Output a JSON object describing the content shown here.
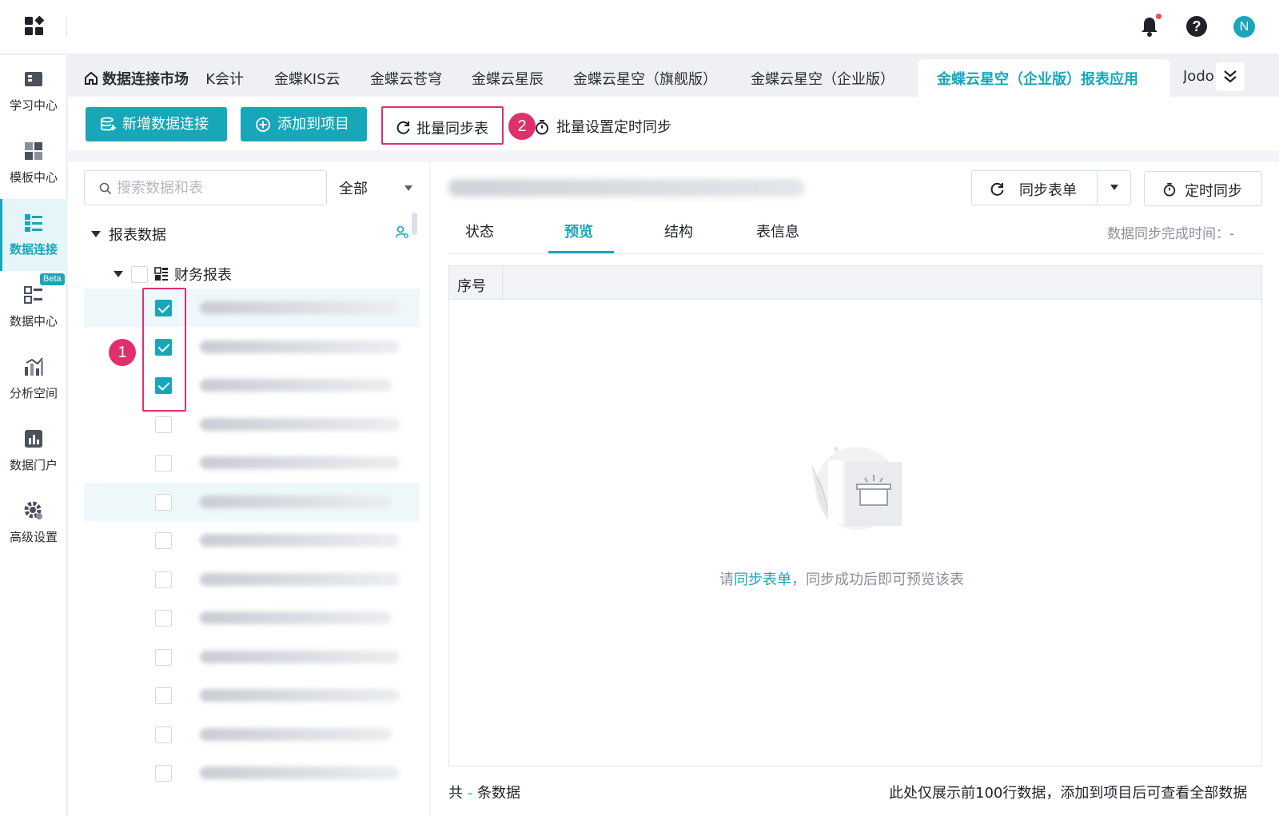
{
  "header": {
    "avatar_initial": "N",
    "help_glyph": "?",
    "icons": [
      "app-grid-icon",
      "bell-icon",
      "help-icon"
    ]
  },
  "sidebar": {
    "items": [
      {
        "label": "学习中心",
        "icon": "book-icon"
      },
      {
        "label": "模板中心",
        "icon": "template-icon"
      },
      {
        "label": "数据连接",
        "icon": "data-connect-icon",
        "active": true
      },
      {
        "label": "数据中心",
        "icon": "data-center-icon",
        "badge": "Beta"
      },
      {
        "label": "分析空间",
        "icon": "analysis-icon"
      },
      {
        "label": "数据门户",
        "icon": "portal-icon"
      },
      {
        "label": "高级设置",
        "icon": "settings-gear-icon"
      }
    ]
  },
  "tabs": {
    "home": "数据连接市场",
    "items": [
      "K会计",
      "金蝶KIS云",
      "金蝶云苍穹",
      "金蝶云星辰",
      "金蝶云星空（旗舰版）",
      "金蝶云星空（企业版）",
      "金蝶云星空（企业版）报表应用",
      "Jodo"
    ],
    "active_index": 6
  },
  "toolbar": {
    "new_connection": "新增数据连接",
    "add_to_project": "添加到项目",
    "batch_sync": "批量同步表",
    "batch_schedule": "批量设置定时同步"
  },
  "annotations": {
    "marker_1": "1",
    "marker_2": "2",
    "color": "#e0306c"
  },
  "left_panel": {
    "search_placeholder": "搜索数据和表",
    "filter_value": "全部",
    "tree_root": "报表数据",
    "tree_group": "财务报表",
    "rows_checked": [
      true,
      true,
      true,
      false,
      false,
      false,
      false,
      false,
      false,
      false,
      false,
      false,
      false
    ]
  },
  "right_panel": {
    "sync_form_button": "同步表单",
    "timer_button": "定时同步",
    "tabs": [
      "状态",
      "预览",
      "结构",
      "表信息"
    ],
    "active_tab": "预览",
    "sync_time_label": "数据同步完成时间：-",
    "grid_header": "序号",
    "empty_prefix": "请",
    "empty_link": "同步表单",
    "empty_suffix": "，同步成功后即可预览该表",
    "footer_left_prefix": "共 ",
    "footer_left_dash": "-",
    "footer_left_suffix": " 条数据",
    "footer_right": "此处仅展示前100行数据，添加到项目后可查看全部数据"
  },
  "colors": {
    "accent": "#17a7b8",
    "highlight": "#e0306c"
  }
}
